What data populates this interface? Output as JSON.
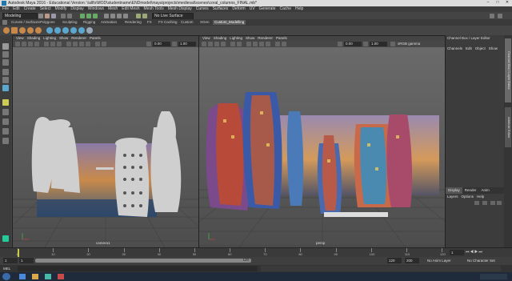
{
  "title_bar": {
    "title": "Autodesk Maya 2016 - Educational Version: \\\\allfs\\MOD\\studentname\\ENDmodel\\maya\\projects\\medieval\\scenes\\coral_columns_FINAL.mb*"
  },
  "menu": [
    "File",
    "Edit",
    "Create",
    "Select",
    "Modify",
    "Display",
    "Windows",
    "Mesh",
    "Edit Mesh",
    "Mesh Tools",
    "Mesh Display",
    "Curves",
    "Surfaces",
    "Deform",
    "UV",
    "Generate",
    "Cache",
    "Help"
  ],
  "status_line": {
    "mode": "Modeling",
    "live_surface": "No Live Surface"
  },
  "shelf_tabs": [
    "Curves / Surfaces",
    "Polygons",
    "Sculpting",
    "Rigging",
    "Animation",
    "Rendering",
    "FX",
    "FX Caching",
    "Custom",
    "XGen",
    "Custom_Modelling"
  ],
  "active_shelf_tab": "Custom_Modelling",
  "panel_menu": [
    "View",
    "Shading",
    "Lighting",
    "Show",
    "Renderer",
    "Panels"
  ],
  "viewports": [
    {
      "camera": "camera1",
      "field_a": "0.00",
      "field_b": "1.00"
    },
    {
      "camera": "persp",
      "field_a": "0.00",
      "field_b": "1.00",
      "color_space": "sRGB gamma"
    }
  ],
  "channel_box": {
    "title": "Channel Box / Layer Editor",
    "menu": [
      "Channels",
      "Edit",
      "Object",
      "Show"
    ]
  },
  "layer_editor": {
    "tabs": [
      "Display",
      "Render",
      "Anim"
    ],
    "menu": [
      "Layers",
      "Options",
      "Help"
    ]
  },
  "side_tabs": [
    "Channel Box / Layer Editor",
    "Attribute Editor"
  ],
  "timeline": {
    "ticks": [
      "1",
      "10",
      "20",
      "30",
      "40",
      "50",
      "60",
      "70",
      "80",
      "90",
      "100",
      "110",
      "120"
    ],
    "current": "1"
  },
  "range": {
    "start": "1",
    "range_start": "1",
    "range_end": "120",
    "end": "120",
    "max": "200",
    "anim_layer": "No Anim Layer",
    "character": "No Character Set"
  },
  "command_line": {
    "lang": "MEL"
  },
  "colors": {
    "accent": "#5aa7d0",
    "active_tab": "#5a5a5a",
    "viewport_bg": "#5f5f5f"
  }
}
